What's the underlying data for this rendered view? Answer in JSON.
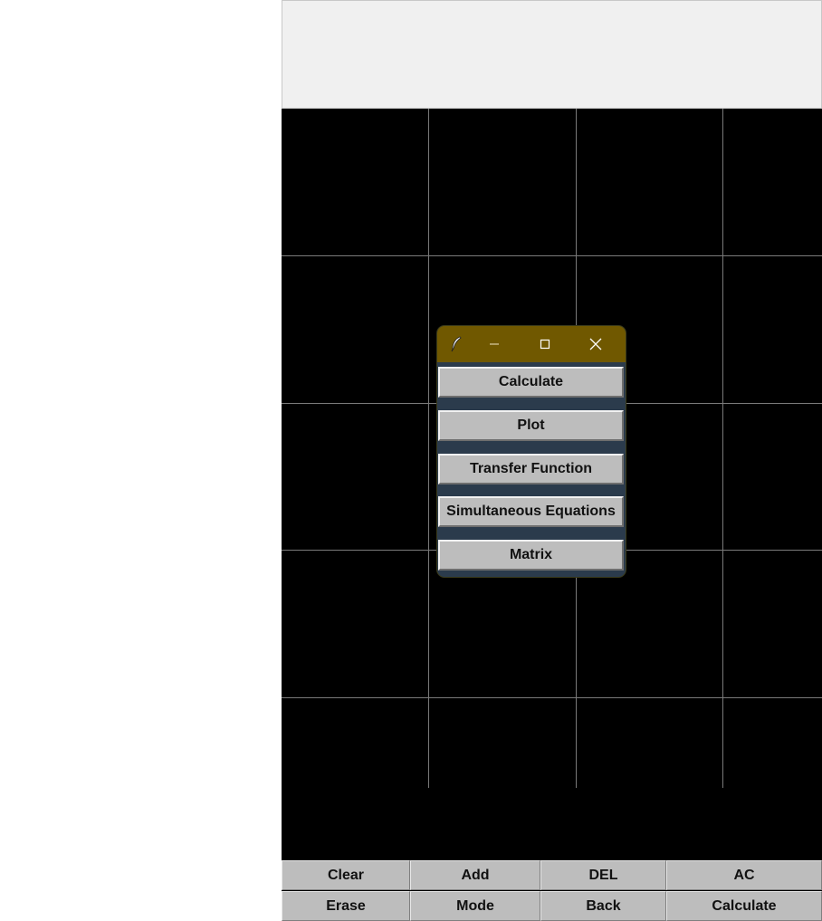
{
  "popup": {
    "titlebar": {
      "app_icon": "feather-icon",
      "minimize_icon": "minimize-icon",
      "maximize_icon": "maximize-icon",
      "close_icon": "close-icon"
    },
    "buttons": [
      {
        "label": "Calculate"
      },
      {
        "label": "Plot"
      },
      {
        "label": "Transfer Function"
      },
      {
        "label": "Simultaneous Equations"
      },
      {
        "label": "Matrix"
      }
    ],
    "colors": {
      "titlebar": "#705800",
      "body": "#2b3b4c",
      "button": "#bdbdbd"
    }
  },
  "display": {
    "value": ""
  },
  "keypad": {
    "rows": [
      [
        "Clear",
        "Add",
        "DEL",
        "AC"
      ],
      [
        "Erase",
        "Mode",
        "Back",
        "Calculate"
      ]
    ]
  },
  "colors": {
    "canvas": "#000000",
    "grid": "#7a7a7a",
    "display": "#f0f0f0"
  }
}
